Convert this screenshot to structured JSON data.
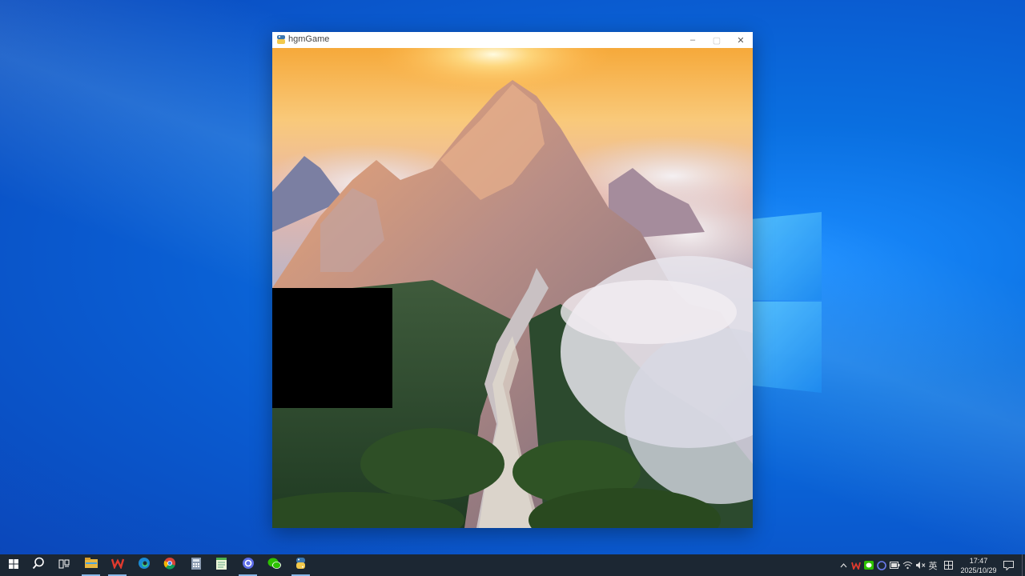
{
  "window": {
    "title": "hgmGame",
    "controls": {
      "minimize": "–",
      "maximize": "▢",
      "close": "✕"
    }
  },
  "game": {
    "scene": "mountain-sunrise-puzzle",
    "empty_tile": {
      "row": 2,
      "col": 0
    }
  },
  "taskbar": {
    "pinned": [
      "start-icon",
      "search-icon",
      "task-view-icon",
      "file-explorer-icon",
      "wps-office-icon",
      "edge-icon",
      "chrome-icon",
      "calculator-icon",
      "notepad-icon",
      "app-icon",
      "wechat-icon",
      "python-icon"
    ],
    "tray": {
      "ime": "英",
      "time": "17:47",
      "date": "2025/10/29"
    }
  },
  "colors": {
    "taskbar": "#1c2733",
    "desktop": "#0a6fe0"
  }
}
